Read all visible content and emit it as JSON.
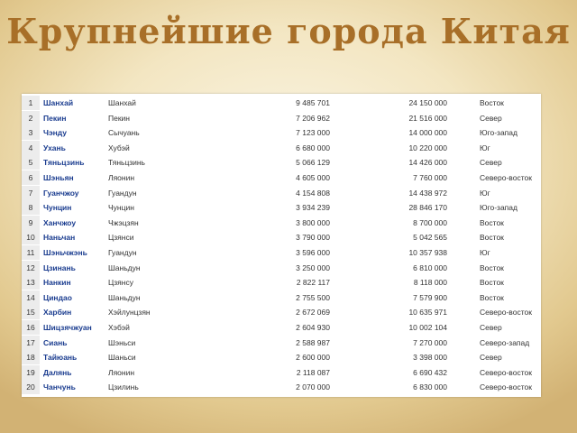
{
  "title": "Крупнейшие города Китая",
  "table": {
    "rows": [
      {
        "num": "1",
        "city": "Шанхай",
        "province": "Шанхай",
        "pop_city": "9 485 701",
        "pop_agglo": "24 150 000",
        "region": "Восток"
      },
      {
        "num": "2",
        "city": "Пекин",
        "province": "Пекин",
        "pop_city": "7 206 962",
        "pop_agglo": "21 516 000",
        "region": "Север"
      },
      {
        "num": "3",
        "city": "Чэнду",
        "province": "Сычуань",
        "pop_city": "7 123 000",
        "pop_agglo": "14 000 000",
        "region": "Юго-запад"
      },
      {
        "num": "4",
        "city": "Ухань",
        "province": "Хубэй",
        "pop_city": "6 680 000",
        "pop_agglo": "10 220 000",
        "region": "Юг"
      },
      {
        "num": "5",
        "city": "Тяньцзинь",
        "province": "Тяньцзинь",
        "pop_city": "5 066 129",
        "pop_agglo": "14 426 000",
        "region": "Север"
      },
      {
        "num": "6",
        "city": "Шэньян",
        "province": "Ляонин",
        "pop_city": "4 605 000",
        "pop_agglo": "7 760 000",
        "region": "Северо-восток"
      },
      {
        "num": "7",
        "city": "Гуанчжоу",
        "province": "Гуандун",
        "pop_city": "4 154 808",
        "pop_agglo": "14 438 972",
        "region": "Юг"
      },
      {
        "num": "8",
        "city": "Чунцин",
        "province": "Чунцин",
        "pop_city": "3 934 239",
        "pop_agglo": "28 846 170",
        "region": "Юго-запад"
      },
      {
        "num": "9",
        "city": "Ханчжоу",
        "province": "Чжэцзян",
        "pop_city": "3 800 000",
        "pop_agglo": "8 700 000",
        "region": "Восток"
      },
      {
        "num": "10",
        "city": "Наньчан",
        "province": "Цзянси",
        "pop_city": "3 790 000",
        "pop_agglo": "5 042 565",
        "region": "Восток"
      },
      {
        "num": "11",
        "city": "Шэньчжэнь",
        "province": "Гуандун",
        "pop_city": "3 596 000",
        "pop_agglo": "10 357 938",
        "region": "Юг"
      },
      {
        "num": "12",
        "city": "Цзинань",
        "province": "Шаньдун",
        "pop_city": "3 250 000",
        "pop_agglo": "6 810 000",
        "region": "Восток"
      },
      {
        "num": "13",
        "city": "Нанкин",
        "province": "Цзянсу",
        "pop_city": "2 822 117",
        "pop_agglo": "8 118 000",
        "region": "Восток"
      },
      {
        "num": "14",
        "city": "Циндао",
        "province": "Шаньдун",
        "pop_city": "2 755 500",
        "pop_agglo": "7 579 900",
        "region": "Восток"
      },
      {
        "num": "15",
        "city": "Харбин",
        "province": "Хэйлунцзян",
        "pop_city": "2 672 069",
        "pop_agglo": "10 635 971",
        "region": "Северо-восток"
      },
      {
        "num": "16",
        "city": "Шицзячжуан",
        "province": "Хэбэй",
        "pop_city": "2 604 930",
        "pop_agglo": "10 002 104",
        "region": "Север"
      },
      {
        "num": "17",
        "city": "Сиань",
        "province": "Шэньси",
        "pop_city": "2 588 987",
        "pop_agglo": "7 270 000",
        "region": "Северо-запад"
      },
      {
        "num": "18",
        "city": "Тайюань",
        "province": "Шаньси",
        "pop_city": "2 600 000",
        "pop_agglo": "3 398 000",
        "region": "Север"
      },
      {
        "num": "19",
        "city": "Далянь",
        "province": "Ляонин",
        "pop_city": "2 118 087",
        "pop_agglo": "6 690 432",
        "region": "Северо-восток"
      },
      {
        "num": "20",
        "city": "Чанчунь",
        "province": "Цзилинь",
        "pop_city": "2 070 000",
        "pop_agglo": "6 830 000",
        "region": "Северо-восток"
      }
    ]
  }
}
